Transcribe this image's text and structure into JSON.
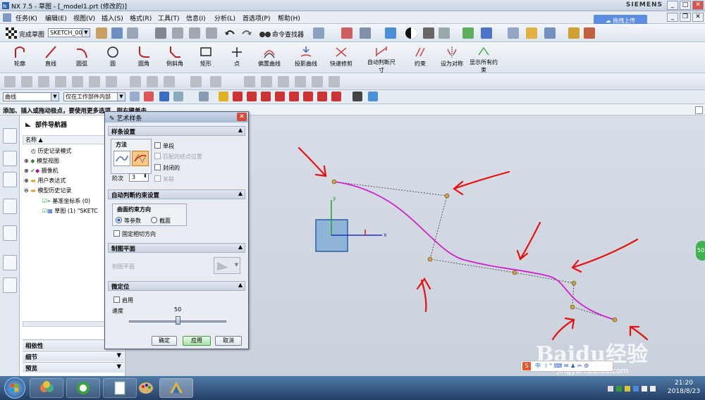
{
  "window": {
    "title": "NX 7.5 - 草图 - [_model1.prt (修改的)]",
    "brand": "SIEMENS"
  },
  "menu": [
    "任务(K)",
    "编辑(E)",
    "视图(V)",
    "插入(S)",
    "格式(R)",
    "工具(T)",
    "信息(I)",
    "分析(L)",
    "首选项(P)",
    "帮助(H)"
  ],
  "cloud_button": "拖拽上传",
  "toolbar1": {
    "finish_sketch": "完成草图",
    "sketch_combo": "SKETCH_000",
    "command_finder": "命令查找器"
  },
  "sketch_tools": [
    {
      "label": "轮廓"
    },
    {
      "label": "直线"
    },
    {
      "label": "圆弧"
    },
    {
      "label": "圆"
    },
    {
      "label": "圆角"
    },
    {
      "label": "倒斜角"
    },
    {
      "label": "矩形"
    },
    {
      "label": "点"
    },
    {
      "label": "偏置曲线"
    },
    {
      "label": "投影曲线"
    },
    {
      "label": "快速修剪"
    },
    {
      "label": "自动判断尺寸"
    },
    {
      "label": "约束"
    },
    {
      "label": "设为对称"
    },
    {
      "label": "显示所有约束"
    }
  ],
  "filter": {
    "type": "曲线",
    "scope": "仅在工作部件内部"
  },
  "status_text": "添加、插入或拖动极点，要使用更多选项，则右键单击",
  "navigator": {
    "title": "部件导航器",
    "col_name": "名称",
    "items": [
      "历史记录模式",
      "模型视图",
      "摄像机",
      "用户表达式",
      "模型历史记录",
      "基准坐标系 (0)",
      "草图 (1) \"SKETC"
    ],
    "panels": [
      "相依性",
      "细节",
      "预览"
    ]
  },
  "dialog": {
    "title": "艺术样条",
    "sec1": "样条设置",
    "method": "方法",
    "single_segment": "单段",
    "match_knot": "匹配的结点位置",
    "closed": "封闭的",
    "associative": "关联",
    "degree_label": "阶次",
    "degree": "3",
    "sec2": "自动判断约束设置",
    "surface_dir": "曲面约束方向",
    "iso_param": "等参数",
    "section": "截面",
    "fixed_tangent": "固定相切方向",
    "sec3": "制图平面",
    "draw_plane": "制图平面",
    "sec4": "微定位",
    "enable": "启用",
    "speed_label": "速度",
    "speed_value": "50",
    "speed_fraction": 0.5,
    "ok": "确定",
    "apply": "应用",
    "cancel": "取消"
  },
  "axes": {
    "x": "x",
    "y": "y"
  },
  "side_badge": "50",
  "taskbar": {
    "time": "21:20",
    "date": "2018/8/23"
  },
  "watermark": {
    "main": "Baidu经验",
    "url": "jingyan.baidu.com"
  },
  "colors": {
    "spline": "#d020d0",
    "arrow": "#e81010",
    "accent": "#5c8de0"
  }
}
